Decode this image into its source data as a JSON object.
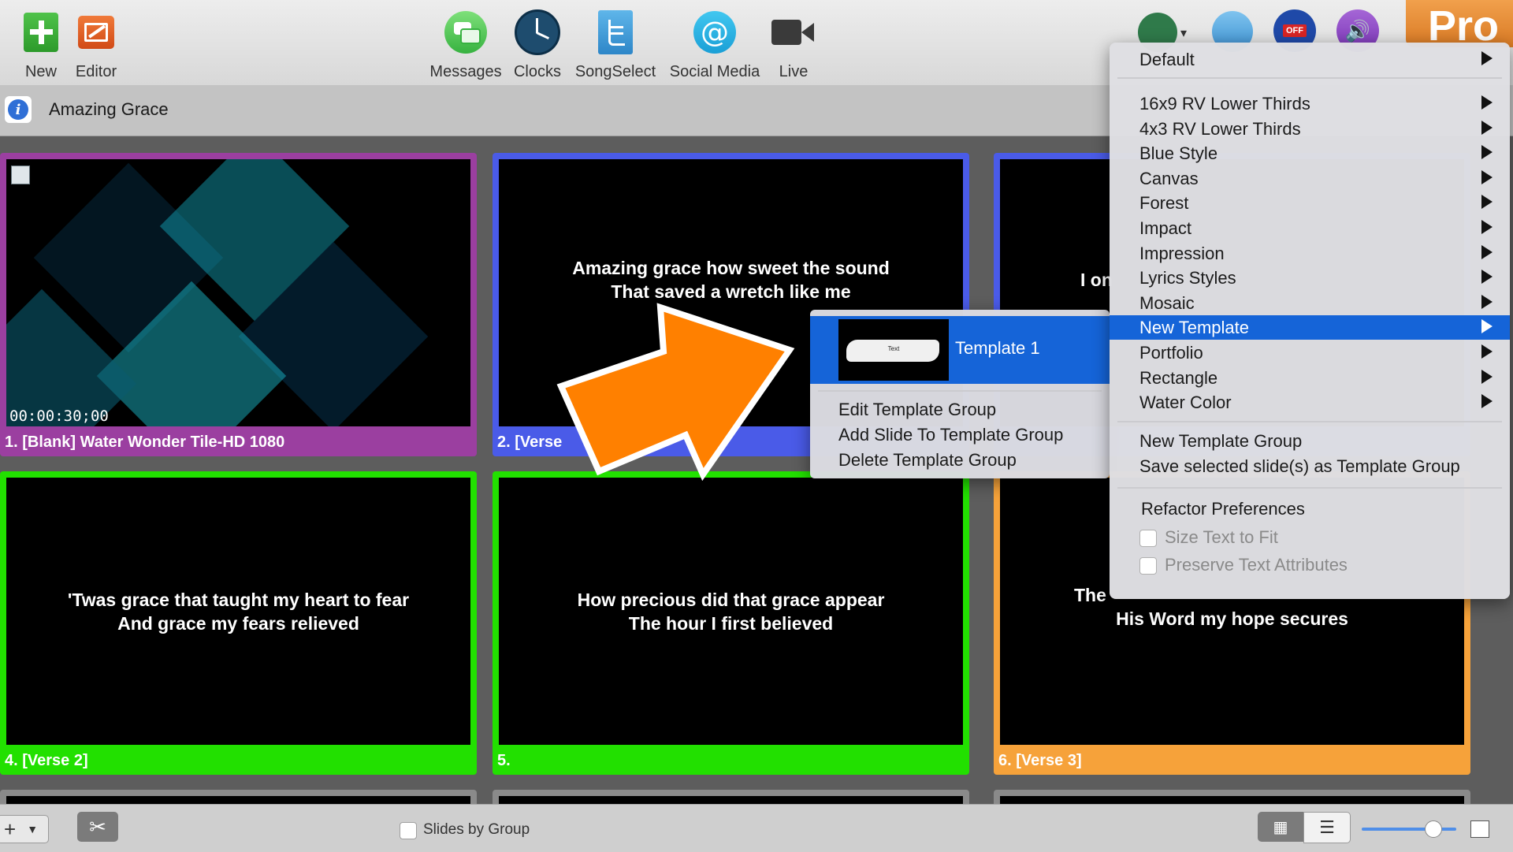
{
  "toolbar": {
    "left": [
      {
        "label": "New",
        "icon": "plus-document-icon"
      },
      {
        "label": "Editor",
        "icon": "editor-icon"
      }
    ],
    "center": [
      {
        "label": "Messages",
        "icon": "messages-icon"
      },
      {
        "label": "Clocks",
        "icon": "clock-icon"
      },
      {
        "label": "SongSelect",
        "icon": "songselect-icon"
      },
      {
        "label": "Social Media",
        "icon": "at-sign-icon"
      },
      {
        "label": "Live",
        "icon": "video-camera-icon"
      }
    ],
    "pro_badge": "Pro",
    "off_badge": "OFF"
  },
  "document": {
    "title": "Amazing Grace"
  },
  "slides": [
    {
      "label": "1. [Blank] Water Wonder Tile-HD 1080",
      "timecode": "00:00:30;00",
      "color": "#9b3fa0"
    },
    {
      "label": "2. [Verse",
      "lines": [
        "Amazing grace how sweet the sound",
        "That saved a wretch like me"
      ],
      "color": "#4a5be8"
    },
    {
      "label": "",
      "lines": [
        "I on"
      ],
      "color": "#4a5be8"
    },
    {
      "label": "4. [Verse 2]",
      "lines": [
        "'Twas grace that taught my heart to fear",
        "And grace my fears relieved"
      ],
      "color": "#22e000"
    },
    {
      "label": "5.",
      "lines": [
        "How precious did that grace appear",
        "The hour I first believed"
      ],
      "color": "#22e000"
    },
    {
      "label": "6. [Verse 3]",
      "lines": [
        "The",
        "His Word my hope secures"
      ],
      "color": "#f6a23a"
    }
  ],
  "main_menu": {
    "default": "Default",
    "templates": [
      "16x9 RV Lower Thirds",
      "4x3 RV Lower Thirds",
      "Blue Style",
      "Canvas",
      "Forest",
      "Impact",
      "Impression",
      "Lyrics Styles",
      "Mosaic",
      "New Template",
      "Portfolio",
      "Rectangle",
      "Water Color"
    ],
    "selected": "New Template",
    "actions": [
      "New Template Group",
      "Save selected slide(s) as Template Group"
    ],
    "refactor": "Refactor Preferences",
    "options": [
      "Size Text to Fit",
      "Preserve Text Attributes"
    ]
  },
  "sub_menu": {
    "template_name": "Template 1",
    "thumb_text": "Text",
    "actions": [
      "Edit Template Group",
      "Add Slide To Template Group",
      "Delete Template Group"
    ]
  },
  "bottom_bar": {
    "slides_by_group": "Slides by Group",
    "zoom": 0.75
  },
  "colors": {
    "accent": "#1564d8",
    "arrow": "#ff8000"
  }
}
